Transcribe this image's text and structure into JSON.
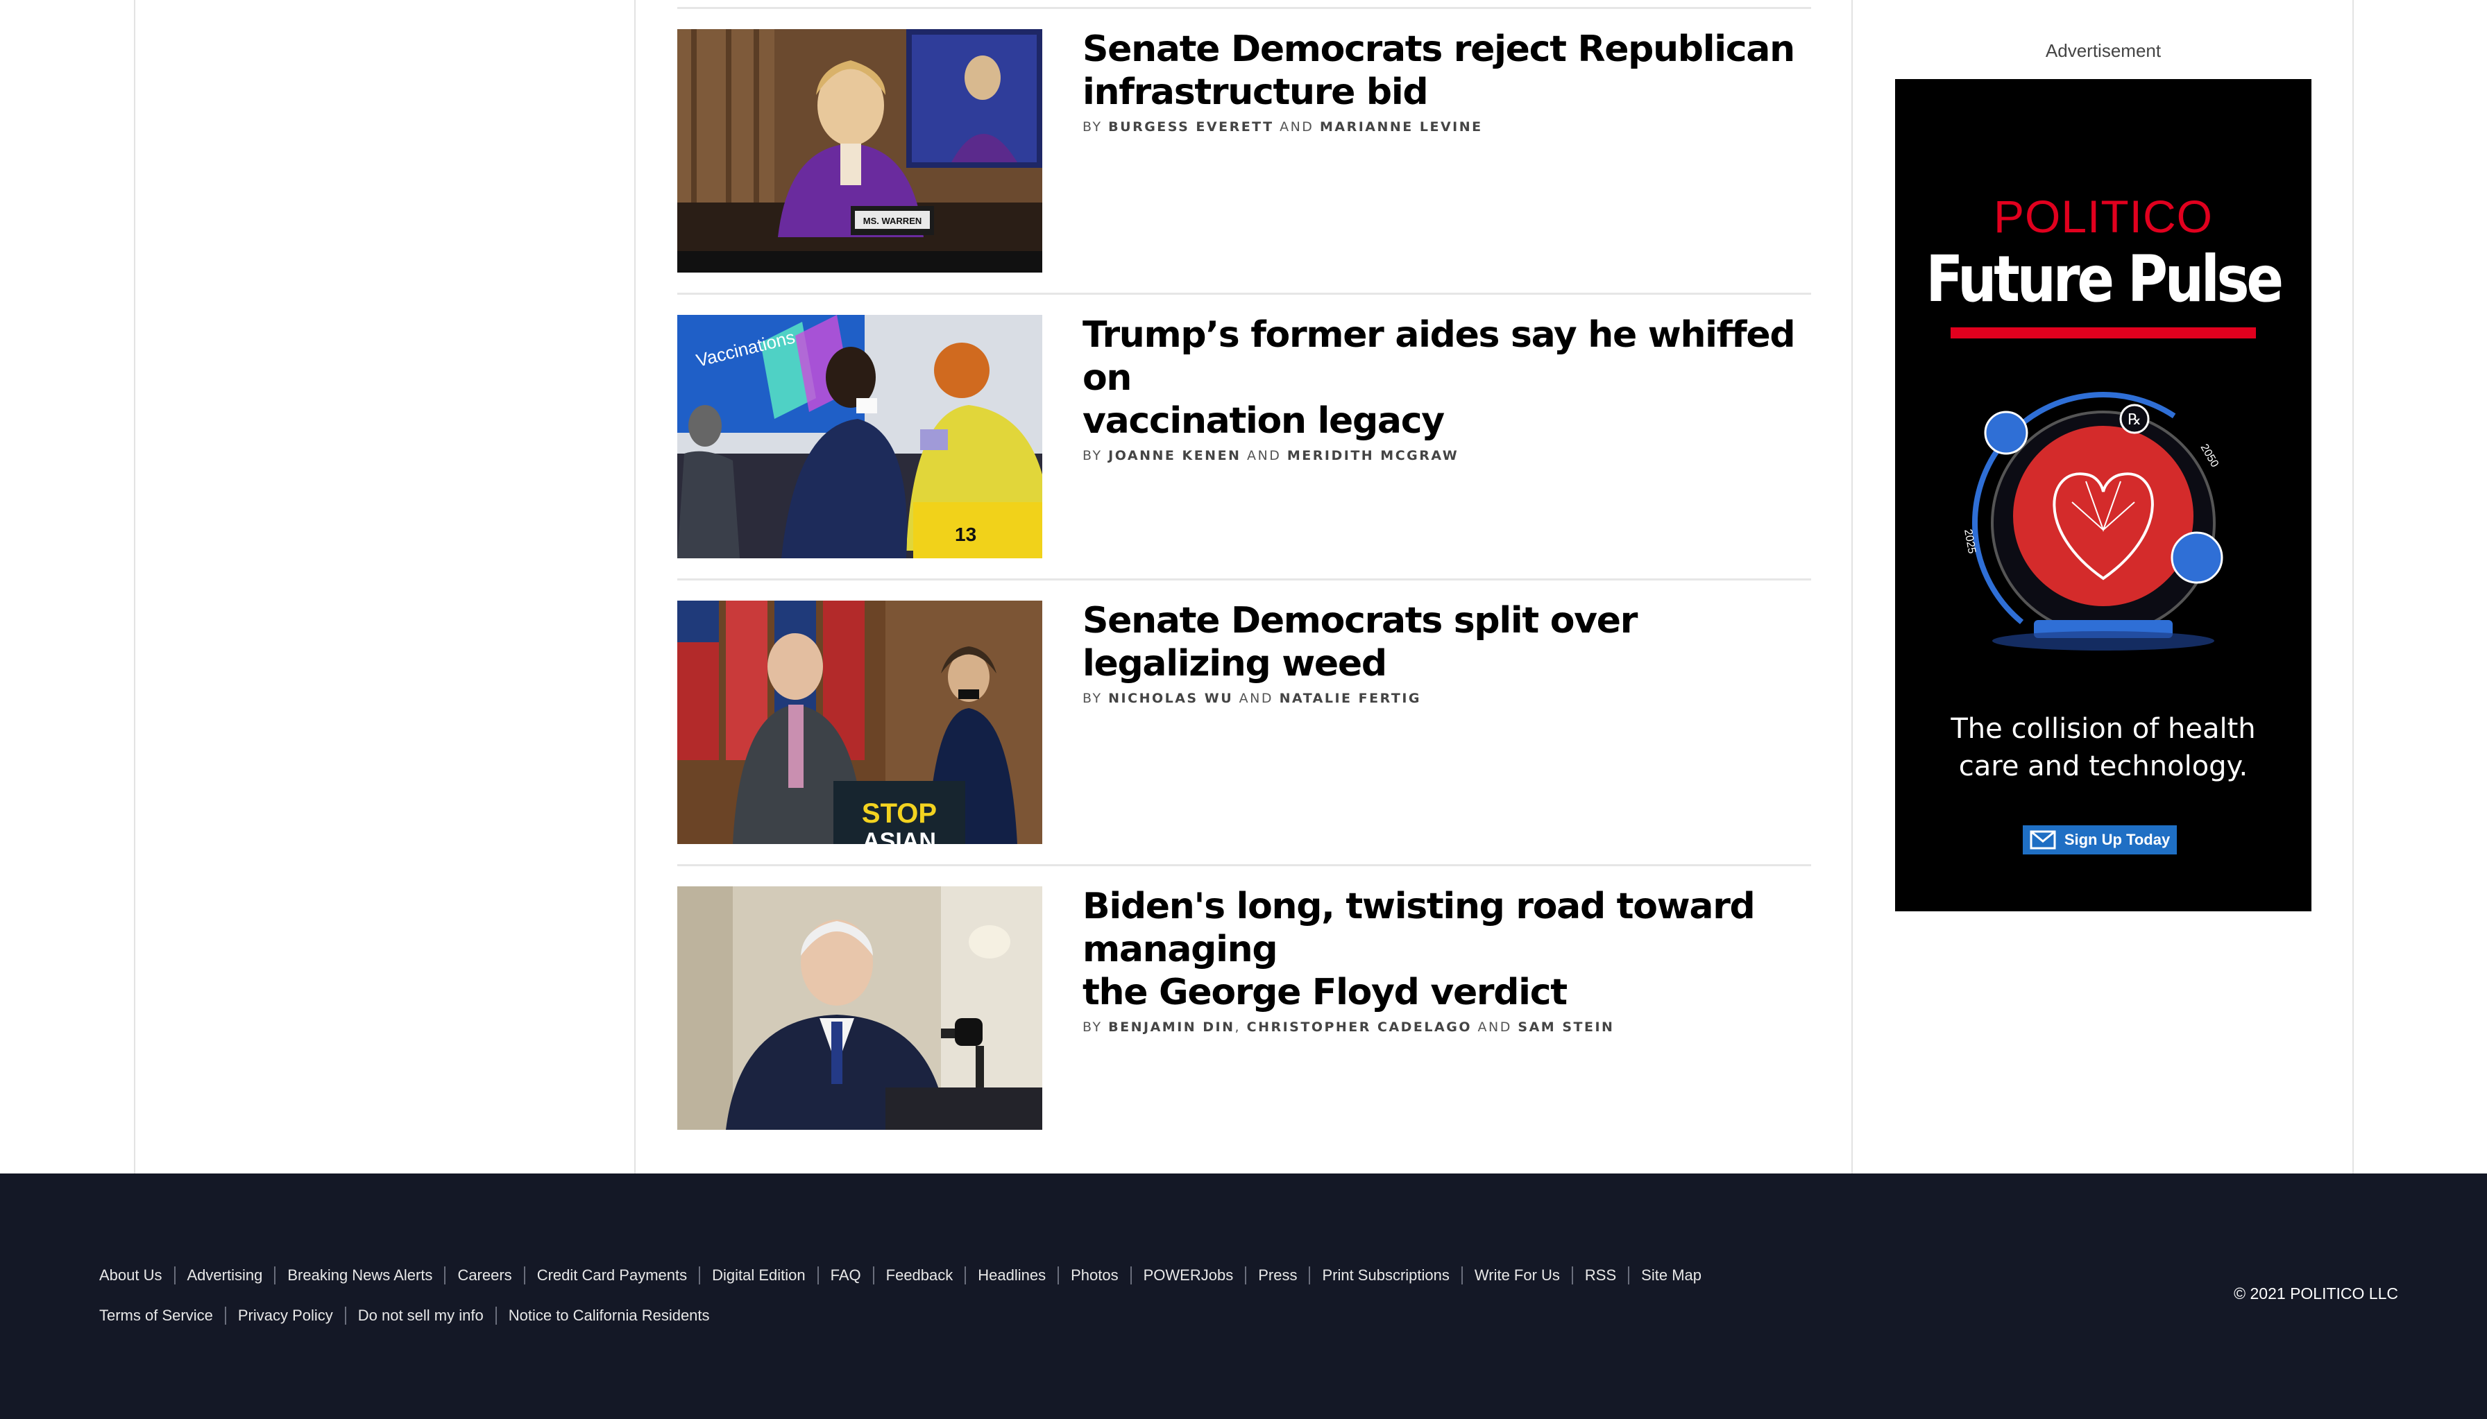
{
  "articles": [
    {
      "headline_lines": [
        "Senate Democrats reject Republican",
        "infrastructure bid"
      ],
      "byline_prefix": "BY",
      "authors": [
        "BURGESS EVERETT",
        "MARIANNE LEVINE"
      ],
      "connectors": [
        "AND"
      ]
    },
    {
      "headline_lines": [
        "Trump’s former aides say he whiffed on",
        "vaccination legacy"
      ],
      "byline_prefix": "BY",
      "authors": [
        "JOANNE KENEN",
        "MERIDITH MCGRAW"
      ],
      "connectors": [
        "AND"
      ]
    },
    {
      "headline_lines": [
        "Senate Democrats split over legalizing weed"
      ],
      "byline_prefix": "BY",
      "authors": [
        "NICHOLAS WU",
        "NATALIE FERTIG"
      ],
      "connectors": [
        "AND"
      ]
    },
    {
      "headline_lines": [
        "Biden's long, twisting road toward managing",
        "the George Floyd verdict"
      ],
      "byline_prefix": "BY",
      "authors": [
        "BENJAMIN DIN",
        "CHRISTOPHER CADELAGO",
        "SAM STEIN"
      ],
      "connectors": [
        ",",
        "AND"
      ]
    }
  ],
  "photo_text": {
    "nameplate": "MS. WARREN",
    "screen": "Vaccinations",
    "number": "13",
    "sign_line1": "STOP",
    "sign_line2": "ASIAN"
  },
  "ad": {
    "label": "Advertisement",
    "brand": "POLITICO",
    "title": "Future Pulse",
    "year_start": "2025",
    "year_end": "2050",
    "rx": "℞",
    "tagline_lines": [
      "The collision of health",
      "care and technology."
    ],
    "button_label": "Sign Up Today",
    "colors": {
      "brand_red": "#e1001e",
      "button_blue": "#1f6fc4"
    }
  },
  "footer": {
    "links_row1": [
      "About Us",
      "Advertising",
      "Breaking News Alerts",
      "Careers",
      "Credit Card Payments",
      "Digital Edition",
      "FAQ",
      "Feedback",
      "Headlines",
      "Photos",
      "POWERJobs",
      "Press",
      "Print Subscriptions",
      "Write For Us",
      "RSS",
      "Site Map"
    ],
    "links_row2": [
      "Terms of Service",
      "Privacy Policy",
      "Do not sell my info",
      "Notice to California Residents"
    ],
    "copyright": "© 2021 POLITICO LLC",
    "colors": {
      "background": "#141826"
    }
  }
}
